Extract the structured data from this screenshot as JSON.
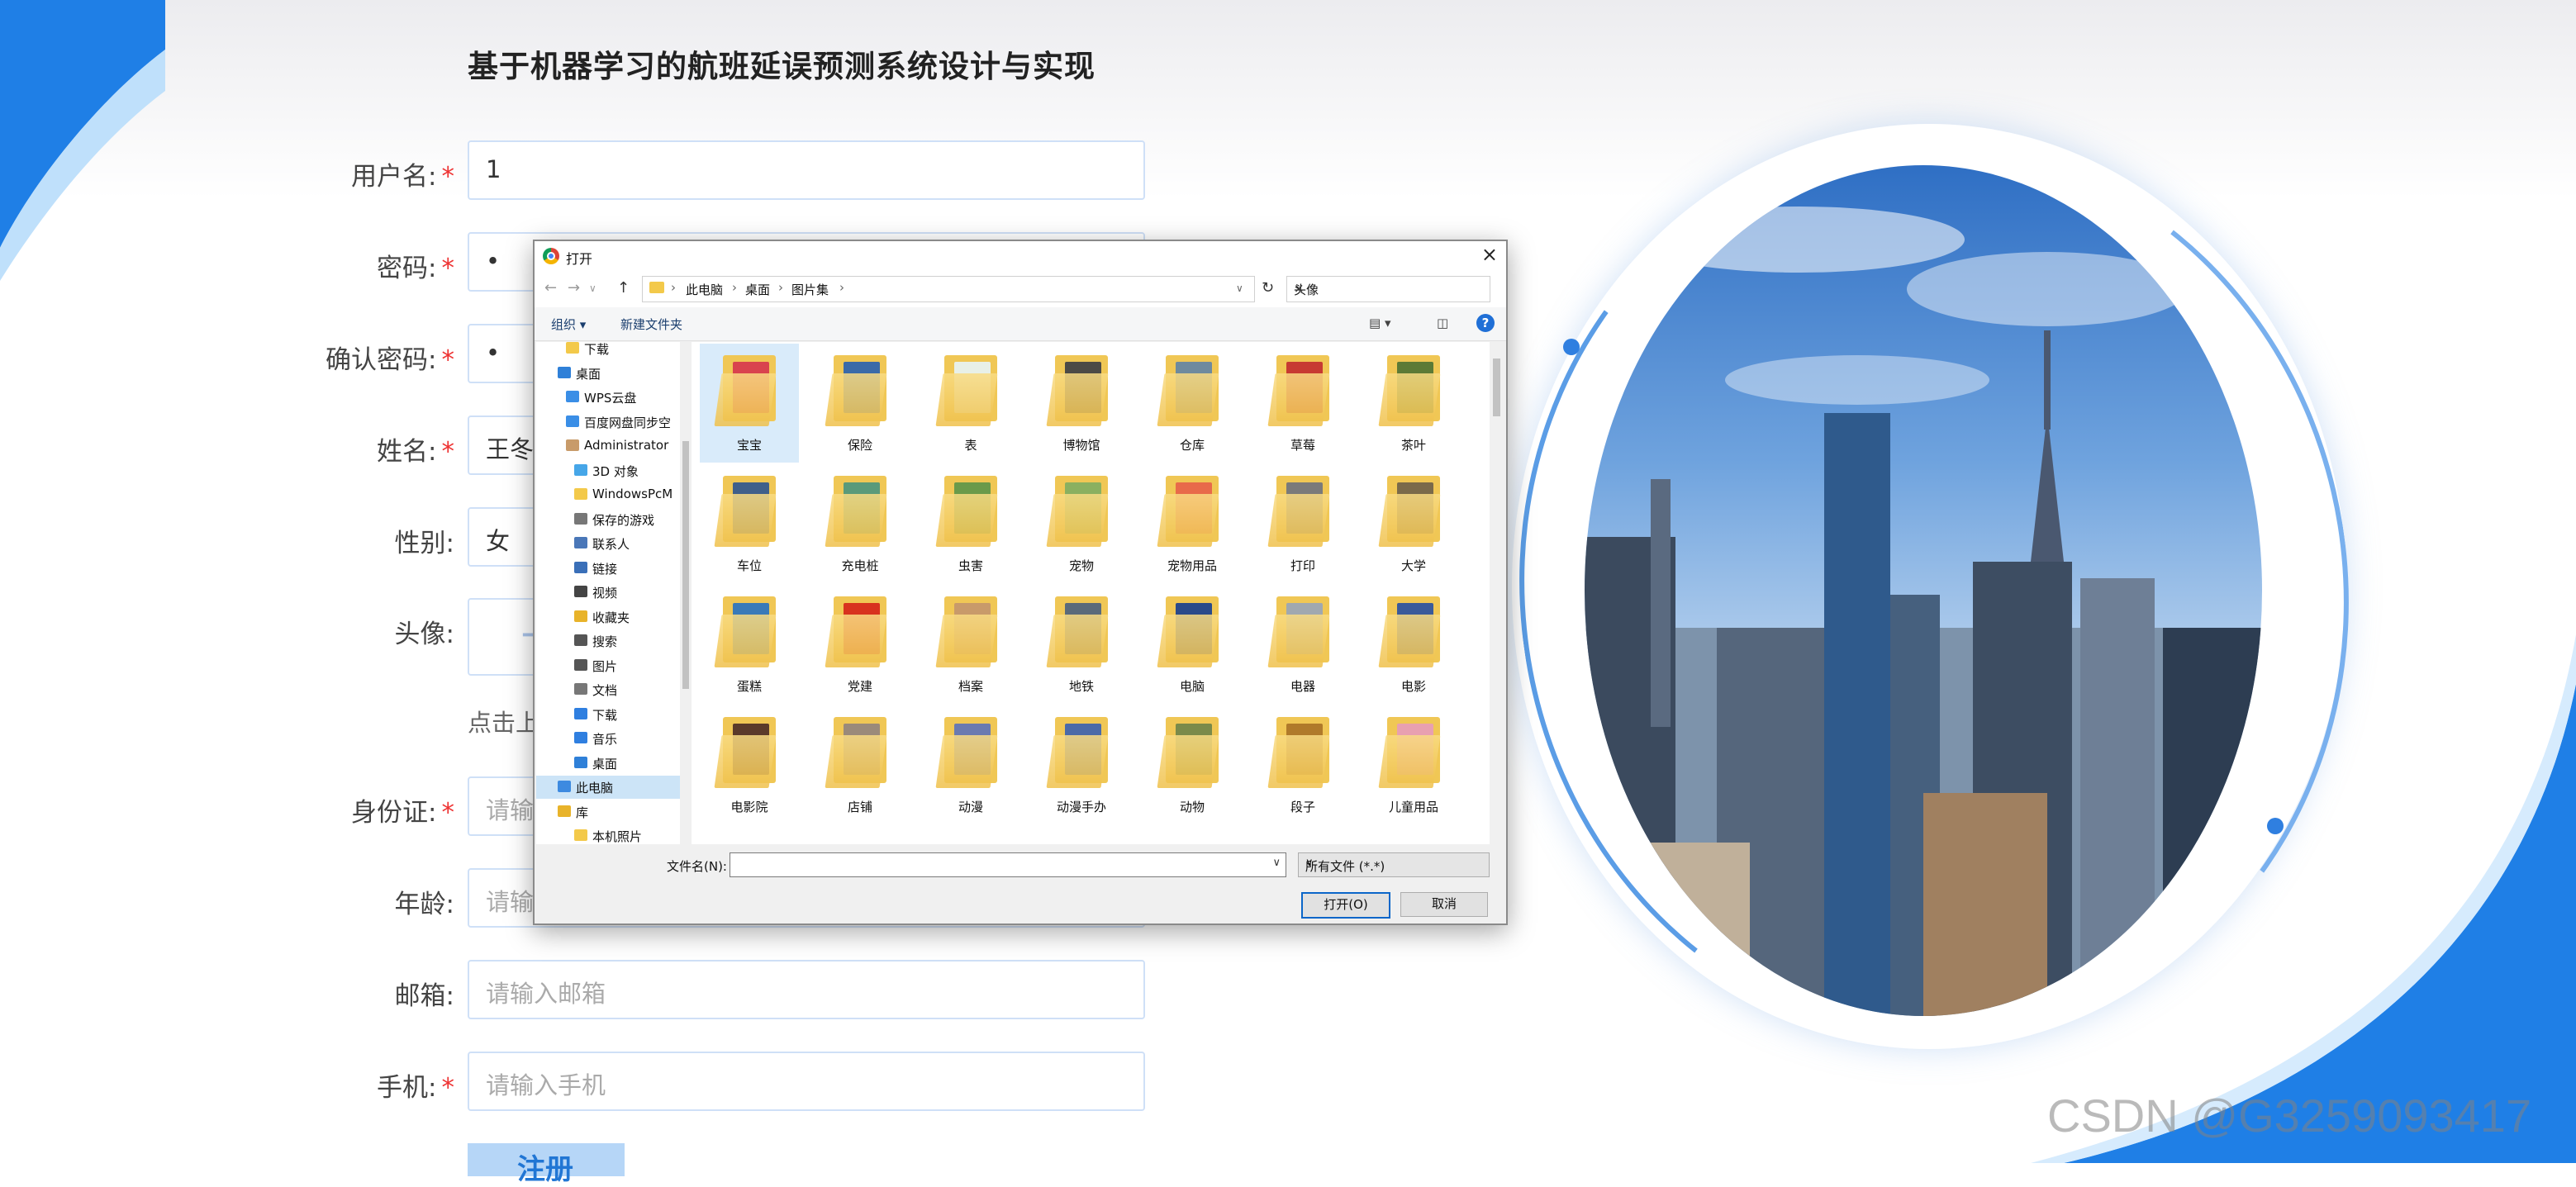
{
  "page": {
    "title": "基于机器学习的航班延误预测系统设计与实现",
    "fields": [
      {
        "label": "用户名:",
        "value": "1",
        "placeholder": ""
      },
      {
        "label": "密码:",
        "value": "•",
        "placeholder": ""
      },
      {
        "label": "确认密码:",
        "value": "•",
        "placeholder": ""
      },
      {
        "label": "姓名:",
        "value": "王冬",
        "placeholder": ""
      },
      {
        "label": "性别:",
        "value": "女",
        "placeholder": ""
      },
      {
        "label": "身份证:",
        "value": "",
        "placeholder": "请输入"
      },
      {
        "label": "年龄:",
        "value": "",
        "placeholder": "请输入"
      },
      {
        "label": "邮箱:",
        "value": "",
        "placeholder": "请输入邮箱"
      },
      {
        "label": "手机:",
        "value": "",
        "placeholder": "请输入手机"
      }
    ],
    "avatar_label": "头像:",
    "avatar_hint": "点击上",
    "register_button": "注册",
    "required_mark": "*"
  },
  "watermark": "CSDN @G3259093417",
  "dialog": {
    "title": "打开",
    "close": "×",
    "breadcrumb": [
      "此电脑",
      "桌面",
      "图片集"
    ],
    "search_value": "头像",
    "toolbar": {
      "organize": "组织 ▾",
      "new_folder": "新建文件夹",
      "help": "?"
    },
    "nav": [
      {
        "label": "下载",
        "icon": "folder-icon",
        "color": "#f3c94a"
      },
      {
        "label": "桌面",
        "icon": "desktop-icon",
        "color": "#2f80d8"
      },
      {
        "label": "WPS云盘",
        "icon": "cloud-icon",
        "color": "#3a8ee6"
      },
      {
        "label": "百度网盘同步空",
        "icon": "baidu-icon",
        "color": "#3a8ee6"
      },
      {
        "label": "Administrator",
        "icon": "user-icon",
        "color": "#c89b6a"
      },
      {
        "label": "3D 对象",
        "icon": "cube-icon",
        "color": "#46a6e8"
      },
      {
        "label": "WindowsPcM",
        "icon": "folder-icon",
        "color": "#f3c94a"
      },
      {
        "label": "保存的游戏",
        "icon": "game-icon",
        "color": "#777777"
      },
      {
        "label": "联系人",
        "icon": "contacts-icon",
        "color": "#4a77b8"
      },
      {
        "label": "链接",
        "icon": "link-icon",
        "color": "#3a6fb8"
      },
      {
        "label": "视频",
        "icon": "video-icon",
        "color": "#444444"
      },
      {
        "label": "收藏夹",
        "icon": "star-icon",
        "color": "#e8b32a"
      },
      {
        "label": "搜索",
        "icon": "search-icon",
        "color": "#555555"
      },
      {
        "label": "图片",
        "icon": "picture-icon",
        "color": "#555555"
      },
      {
        "label": "文档",
        "icon": "document-icon",
        "color": "#777777"
      },
      {
        "label": "下载",
        "icon": "download-icon",
        "color": "#2f7fe0"
      },
      {
        "label": "音乐",
        "icon": "music-icon",
        "color": "#2f7fe0"
      },
      {
        "label": "桌面",
        "icon": "desktop-icon",
        "color": "#2f80d8"
      },
      {
        "label": "此电脑",
        "icon": "computer-icon",
        "color": "#3d8ae0"
      },
      {
        "label": "库",
        "icon": "library-icon",
        "color": "#e8b32a"
      },
      {
        "label": "本机照片",
        "icon": "folder-icon",
        "color": "#f3c94a"
      }
    ],
    "files": [
      {
        "name": "宝宝",
        "color": "#d9434e"
      },
      {
        "name": "保险",
        "color": "#3a6aa8"
      },
      {
        "name": "表",
        "color": "#e8f0e8"
      },
      {
        "name": "博物馆",
        "color": "#4c4a46"
      },
      {
        "name": "仓库",
        "color": "#6e8a9e"
      },
      {
        "name": "草莓",
        "color": "#c73a32"
      },
      {
        "name": "茶叶",
        "color": "#5c7a36"
      },
      {
        "name": "车位",
        "color": "#3f5f8a"
      },
      {
        "name": "充电桩",
        "color": "#5a9a7a"
      },
      {
        "name": "虫害",
        "color": "#6a9a4a"
      },
      {
        "name": "宠物",
        "color": "#8ab060"
      },
      {
        "name": "宠物用品",
        "color": "#e86a4a"
      },
      {
        "name": "打印",
        "color": "#7a7a7a"
      },
      {
        "name": "大学",
        "color": "#7a6a4a"
      },
      {
        "name": "蛋糕",
        "color": "#3a7ab8"
      },
      {
        "name": "党建",
        "color": "#d8321e"
      },
      {
        "name": "档案",
        "color": "#c89a6a"
      },
      {
        "name": "地铁",
        "color": "#5a6a7a"
      },
      {
        "name": "电脑",
        "color": "#2a4a8a"
      },
      {
        "name": "电器",
        "color": "#a0a8b0"
      },
      {
        "name": "电影",
        "color": "#3a5a9a"
      },
      {
        "name": "电影院",
        "color": "#5a3a2a"
      },
      {
        "name": "店铺",
        "color": "#9a8a7a"
      },
      {
        "name": "动漫",
        "color": "#6a7ab0"
      },
      {
        "name": "动漫手办",
        "color": "#4a6aa8"
      },
      {
        "name": "动物",
        "color": "#7a8a4a"
      },
      {
        "name": "段子",
        "color": "#b07a2a"
      },
      {
        "name": "儿童用品",
        "color": "#e8a0b0"
      }
    ],
    "filename_label": "文件名(N):",
    "filename_value": "",
    "filetype": "所有文件 (*.*)",
    "open_button": "打开(O)",
    "cancel_button": "取消"
  }
}
